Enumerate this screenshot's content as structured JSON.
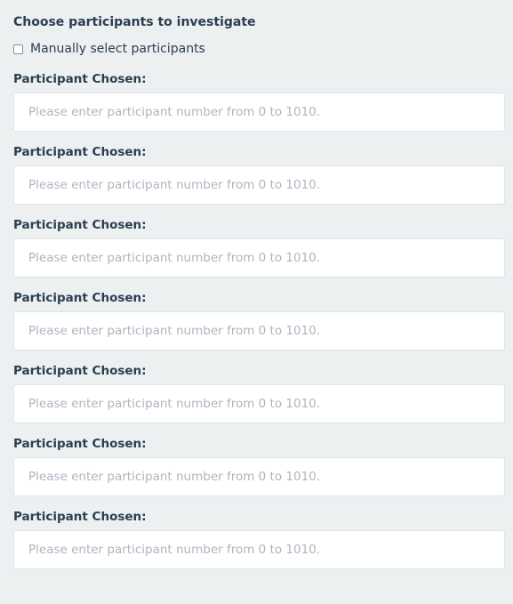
{
  "section": {
    "title": "Choose participants to investigate"
  },
  "manual_select": {
    "label": "Manually select participants",
    "checked": false
  },
  "participants": [
    {
      "label": "Participant Chosen:",
      "placeholder": "Please enter participant number from 0 to 1010."
    },
    {
      "label": "Participant Chosen:",
      "placeholder": "Please enter participant number from 0 to 1010."
    },
    {
      "label": "Participant Chosen:",
      "placeholder": "Please enter participant number from 0 to 1010."
    },
    {
      "label": "Participant Chosen:",
      "placeholder": "Please enter participant number from 0 to 1010."
    },
    {
      "label": "Participant Chosen:",
      "placeholder": "Please enter participant number from 0 to 1010."
    },
    {
      "label": "Participant Chosen:",
      "placeholder": "Please enter participant number from 0 to 1010."
    },
    {
      "label": "Participant Chosen:",
      "placeholder": "Please enter participant number from 0 to 1010."
    }
  ]
}
